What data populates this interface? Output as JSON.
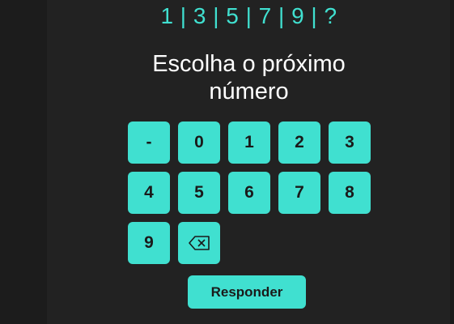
{
  "sequence": "1 | 3 | 5 | 7 | 9 | ?",
  "prompt": {
    "line1": "Escolha o próximo",
    "line2": "número"
  },
  "keypad": {
    "keys": [
      "-",
      "0",
      "1",
      "2",
      "3",
      "4",
      "5",
      "6",
      "7",
      "8",
      "9"
    ],
    "backspace_icon": "backspace-icon"
  },
  "submit_label": "Responder",
  "colors": {
    "accent": "#40e0d0",
    "background": "#222222",
    "text": "#ffffff"
  }
}
